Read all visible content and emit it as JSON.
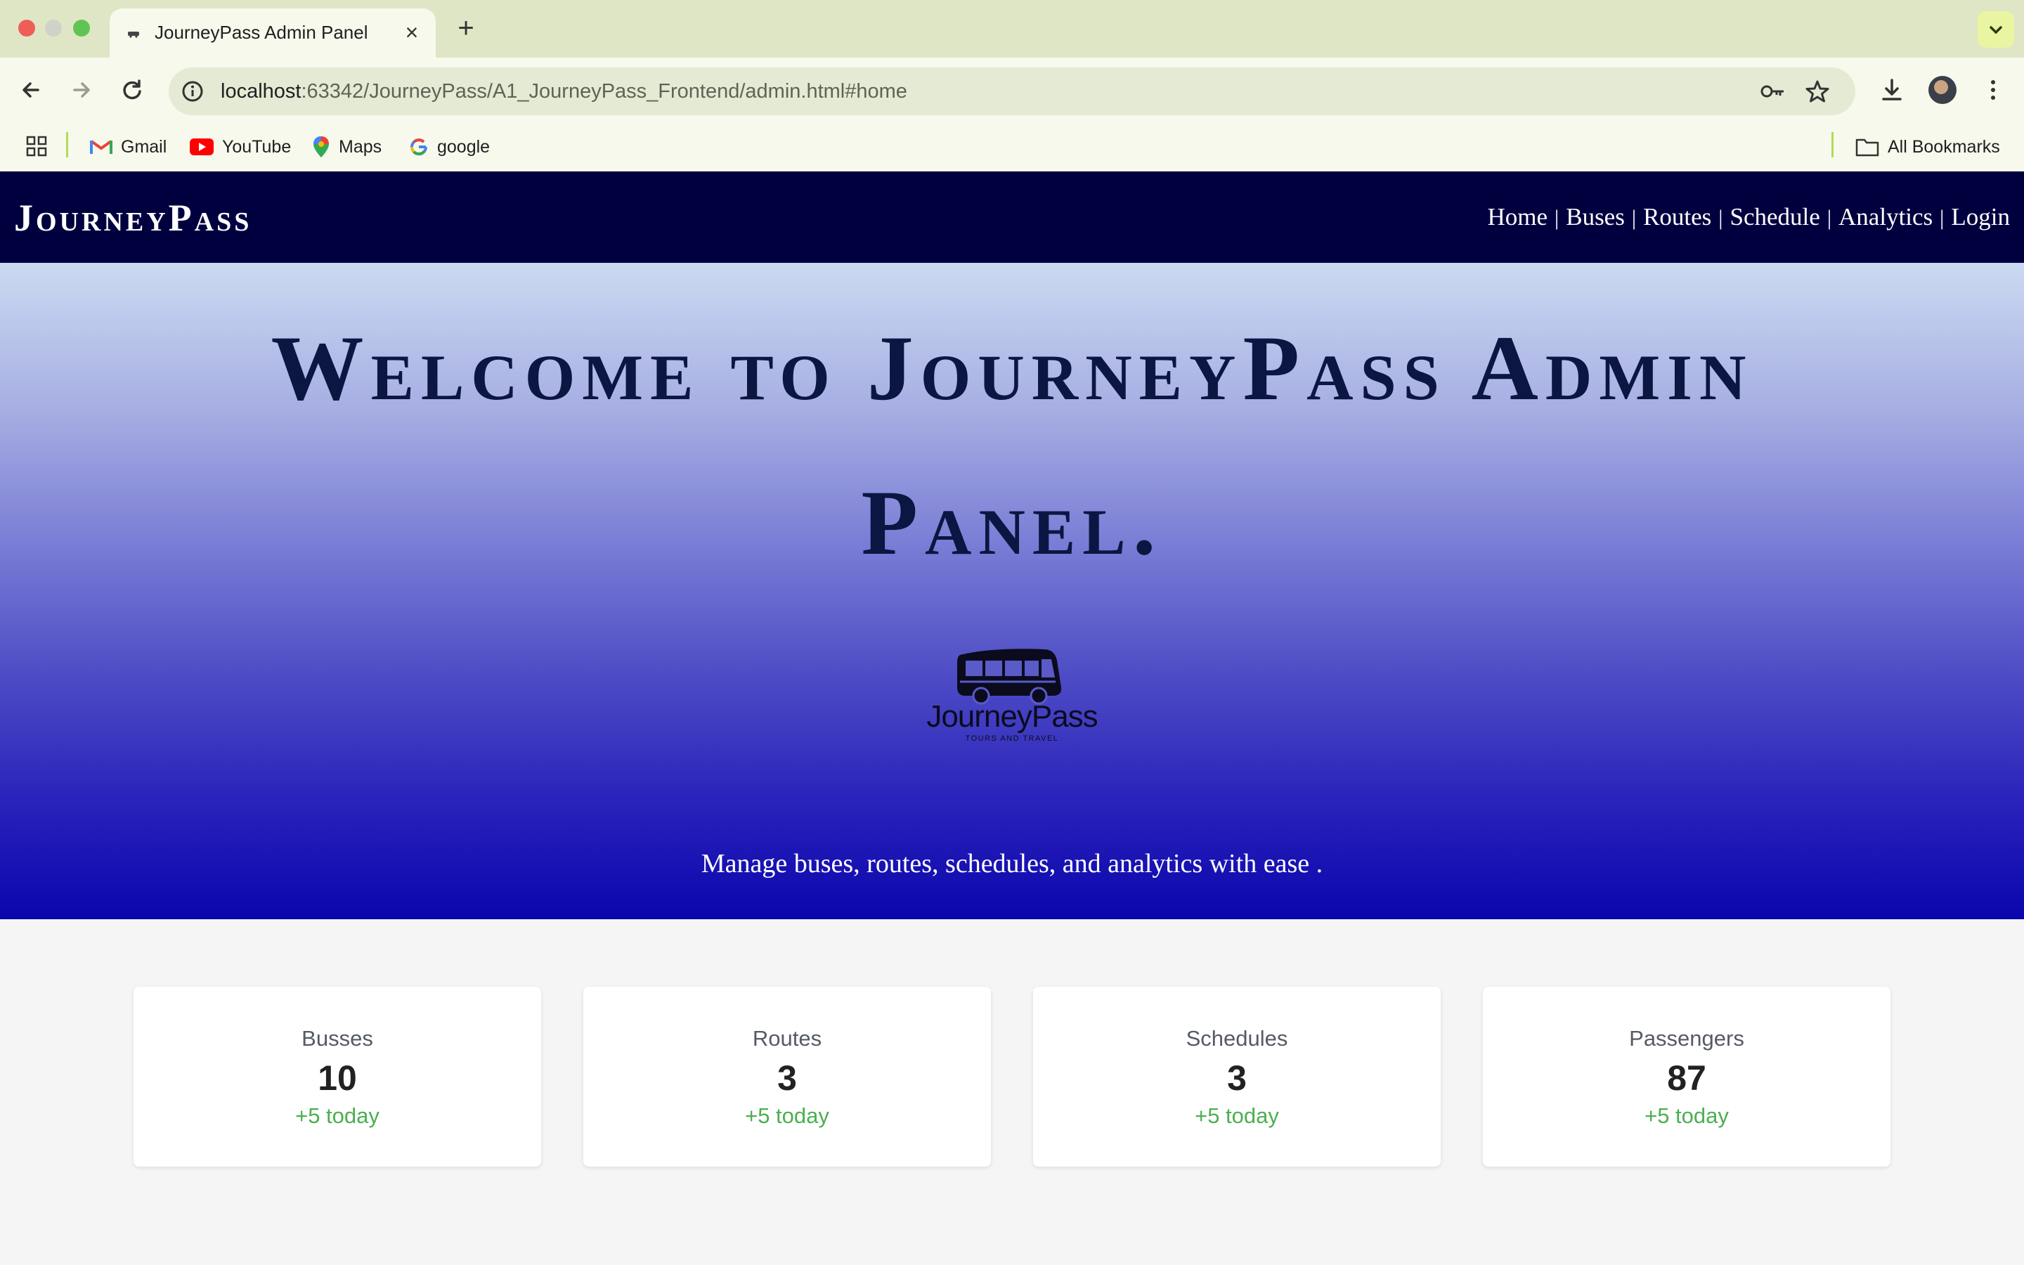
{
  "browser": {
    "tab_title": "JourneyPass Admin Panel",
    "url_host": "localhost",
    "url_rest": ":63342/JourneyPass/A1_JourneyPass_Frontend/admin.html#home",
    "bookmarks": [
      "Gmail",
      "YouTube",
      "Maps",
      "google"
    ],
    "all_bookmarks": "All Bookmarks"
  },
  "header": {
    "brand": "JourneyPass",
    "nav": [
      "Home",
      "Buses",
      "Routes",
      "Schedule",
      "Analytics",
      "Login"
    ]
  },
  "hero": {
    "title": "Welcome to JourneyPass Admin Panel.",
    "logo_text": "JourneyPass",
    "logo_tagline": "TOURS AND TRAVEL",
    "subtitle": "Manage buses, routes, schedules, and analytics with ease ."
  },
  "stats": [
    {
      "label": "Busses",
      "value": "10",
      "delta": "+5 today"
    },
    {
      "label": "Routes",
      "value": "3",
      "delta": "+5 today"
    },
    {
      "label": "Schedules",
      "value": "3",
      "delta": "+5 today"
    },
    {
      "label": "Passengers",
      "value": "87",
      "delta": "+5 today"
    }
  ],
  "colors": {
    "header_bg": "#00003f",
    "hero_top": "#cbdaf1",
    "hero_bottom": "#0a06ad",
    "delta_green": "#4caf50"
  }
}
